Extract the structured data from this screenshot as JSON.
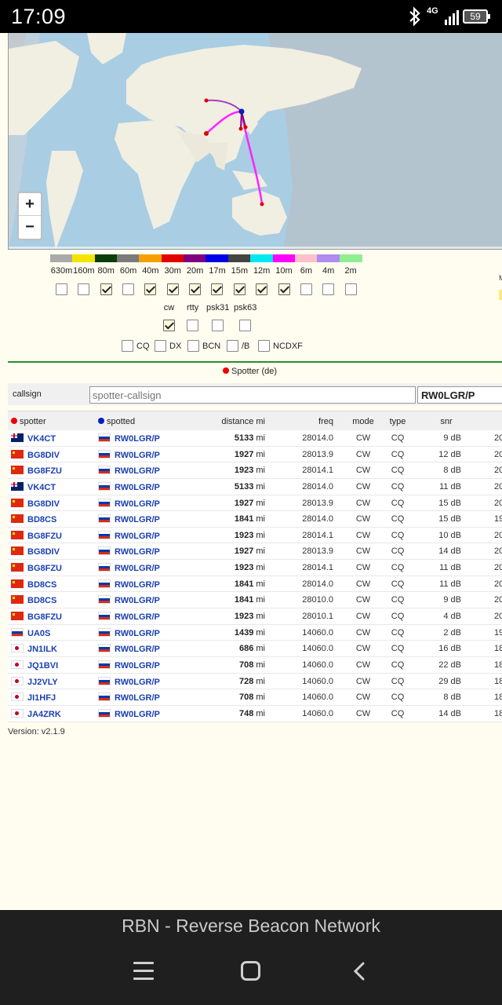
{
  "status_bar": {
    "time": "17:09",
    "network": "4G",
    "battery": "59"
  },
  "map": {
    "zoom_in": "+",
    "zoom_out": "−"
  },
  "bands": {
    "items": [
      {
        "label": "630m",
        "color": "#aaaaaa",
        "checked": false
      },
      {
        "label": "160m",
        "color": "#f5e400",
        "checked": false
      },
      {
        "label": "80m",
        "color": "#0b3d0b",
        "checked": true
      },
      {
        "label": "60m",
        "color": "#7a7a7a",
        "checked": false
      },
      {
        "label": "40m",
        "color": "#f5a000",
        "checked": true
      },
      {
        "label": "30m",
        "color": "#e00000",
        "checked": true
      },
      {
        "label": "20m",
        "color": "#800080",
        "checked": true
      },
      {
        "label": "17m",
        "color": "#0000e8",
        "checked": true
      },
      {
        "label": "15m",
        "color": "#444444",
        "checked": true
      },
      {
        "label": "12m",
        "color": "#00e8f0",
        "checked": true
      },
      {
        "label": "10m",
        "color": "#ff00ff",
        "checked": true
      },
      {
        "label": "6m",
        "color": "#ffc0cb",
        "checked": false
      },
      {
        "label": "4m",
        "color": "#b08cf0",
        "checked": false
      },
      {
        "label": "2m",
        "color": "#90ee90",
        "checked": false
      }
    ],
    "side_label": "M"
  },
  "modes": [
    {
      "label": "cw",
      "checked": true
    },
    {
      "label": "rtty",
      "checked": false
    },
    {
      "label": "psk31",
      "checked": false
    },
    {
      "label": "psk63",
      "checked": false
    }
  ],
  "types": [
    {
      "label": "CQ",
      "checked": false
    },
    {
      "label": "DX",
      "checked": false
    },
    {
      "label": "BCN",
      "checked": false
    },
    {
      "label": "/B",
      "checked": false
    },
    {
      "label": "NCDXF",
      "checked": false
    }
  ],
  "spotter_de_label": "Spotter (de)",
  "callsign_filter": {
    "label": "callsign",
    "spotter_placeholder": "spotter-callsign",
    "spotted_value": "RW0LGR/P"
  },
  "table": {
    "headers": {
      "spotter": "spotter",
      "spotted": "spotted",
      "distance": "distance mi",
      "freq": "freq",
      "mode": "mode",
      "type": "type",
      "snr": "snr"
    },
    "rows": [
      {
        "flag": "au",
        "spotter": "VK4CT",
        "spotted": "RW0LGR/P",
        "distance": "5133",
        "unit": "mi",
        "freq": "28014.0",
        "mode": "CW",
        "type": "CQ",
        "snr": "9 dB",
        "extra": "20"
      },
      {
        "flag": "cn",
        "spotter": "BG8DIV",
        "spotted": "RW0LGR/P",
        "distance": "1927",
        "unit": "mi",
        "freq": "28013.9",
        "mode": "CW",
        "type": "CQ",
        "snr": "12 dB",
        "extra": "20"
      },
      {
        "flag": "cn",
        "spotter": "BG8FZU",
        "spotted": "RW0LGR/P",
        "distance": "1923",
        "unit": "mi",
        "freq": "28014.1",
        "mode": "CW",
        "type": "CQ",
        "snr": "8 dB",
        "extra": "20"
      },
      {
        "flag": "au",
        "spotter": "VK4CT",
        "spotted": "RW0LGR/P",
        "distance": "5133",
        "unit": "mi",
        "freq": "28014.0",
        "mode": "CW",
        "type": "CQ",
        "snr": "11 dB",
        "extra": "20"
      },
      {
        "flag": "cn",
        "spotter": "BG8DIV",
        "spotted": "RW0LGR/P",
        "distance": "1927",
        "unit": "mi",
        "freq": "28013.9",
        "mode": "CW",
        "type": "CQ",
        "snr": "15 dB",
        "extra": "20"
      },
      {
        "flag": "cn",
        "spotter": "BD8CS",
        "spotted": "RW0LGR/P",
        "distance": "1841",
        "unit": "mi",
        "freq": "28014.0",
        "mode": "CW",
        "type": "CQ",
        "snr": "15 dB",
        "extra": "19"
      },
      {
        "flag": "cn",
        "spotter": "BG8FZU",
        "spotted": "RW0LGR/P",
        "distance": "1923",
        "unit": "mi",
        "freq": "28014.1",
        "mode": "CW",
        "type": "CQ",
        "snr": "10 dB",
        "extra": "20"
      },
      {
        "flag": "cn",
        "spotter": "BG8DIV",
        "spotted": "RW0LGR/P",
        "distance": "1927",
        "unit": "mi",
        "freq": "28013.9",
        "mode": "CW",
        "type": "CQ",
        "snr": "14 dB",
        "extra": "20"
      },
      {
        "flag": "cn",
        "spotter": "BG8FZU",
        "spotted": "RW0LGR/P",
        "distance": "1923",
        "unit": "mi",
        "freq": "28014.1",
        "mode": "CW",
        "type": "CQ",
        "snr": "11 dB",
        "extra": "20"
      },
      {
        "flag": "cn",
        "spotter": "BD8CS",
        "spotted": "RW0LGR/P",
        "distance": "1841",
        "unit": "mi",
        "freq": "28014.0",
        "mode": "CW",
        "type": "CQ",
        "snr": "11 dB",
        "extra": "20"
      },
      {
        "flag": "cn",
        "spotter": "BD8CS",
        "spotted": "RW0LGR/P",
        "distance": "1841",
        "unit": "mi",
        "freq": "28010.0",
        "mode": "CW",
        "type": "CQ",
        "snr": "9 dB",
        "extra": "20"
      },
      {
        "flag": "cn",
        "spotter": "BG8FZU",
        "spotted": "RW0LGR/P",
        "distance": "1923",
        "unit": "mi",
        "freq": "28010.1",
        "mode": "CW",
        "type": "CQ",
        "snr": "4 dB",
        "extra": "20"
      },
      {
        "flag": "ru",
        "spotter": "UA0S",
        "spotted": "RW0LGR/P",
        "distance": "1439",
        "unit": "mi",
        "freq": "14060.0",
        "mode": "CW",
        "type": "CQ",
        "snr": "2 dB",
        "extra": "19"
      },
      {
        "flag": "jp",
        "spotter": "JN1ILK",
        "spotted": "RW0LGR/P",
        "distance": "686",
        "unit": "mi",
        "freq": "14060.0",
        "mode": "CW",
        "type": "CQ",
        "snr": "16 dB",
        "extra": "18"
      },
      {
        "flag": "jp",
        "spotter": "JQ1BVI",
        "spotted": "RW0LGR/P",
        "distance": "708",
        "unit": "mi",
        "freq": "14060.0",
        "mode": "CW",
        "type": "CQ",
        "snr": "22 dB",
        "extra": "18"
      },
      {
        "flag": "jp",
        "spotter": "JJ2VLY",
        "spotted": "RW0LGR/P",
        "distance": "728",
        "unit": "mi",
        "freq": "14060.0",
        "mode": "CW",
        "type": "CQ",
        "snr": "29 dB",
        "extra": "18"
      },
      {
        "flag": "jp",
        "spotter": "JI1HFJ",
        "spotted": "RW0LGR/P",
        "distance": "708",
        "unit": "mi",
        "freq": "14060.0",
        "mode": "CW",
        "type": "CQ",
        "snr": "8 dB",
        "extra": "18"
      },
      {
        "flag": "jp",
        "spotter": "JA4ZRK",
        "spotted": "RW0LGR/P",
        "distance": "748",
        "unit": "mi",
        "freq": "14060.0",
        "mode": "CW",
        "type": "CQ",
        "snr": "14 dB",
        "extra": "18"
      }
    ]
  },
  "version": "Version: v2.1.9",
  "browser": {
    "page_title": "RBN - Reverse Beacon Network"
  },
  "colors": {
    "spotter_dot": "#e00000",
    "spotted_dot": "#0020c0",
    "divider": "#2e8b2e",
    "callsign": "#1a3fb0"
  }
}
